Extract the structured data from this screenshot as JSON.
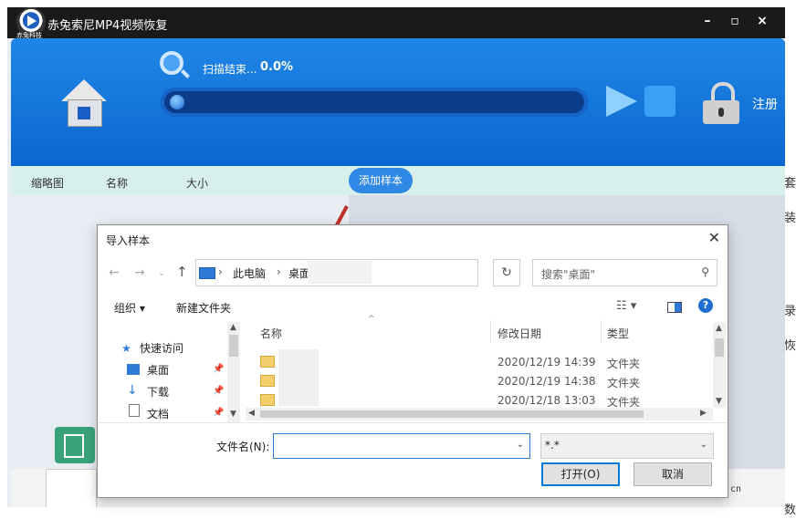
{
  "app": {
    "title": "赤兔索尼MP4视频恢复",
    "logo_text": "赤兔科技",
    "window_controls": [
      "–",
      "▫",
      "×"
    ],
    "scan_status": "扫描结束...",
    "scan_percent": "0.0%",
    "scan_progress": 0.0,
    "register_label": "注册",
    "columns": [
      "缩略图",
      "名称",
      "大小"
    ],
    "add_sample_label": "添加样本",
    "bottom_text": "cn"
  },
  "right_glyphs": [
    "套",
    "装",
    "录",
    "恢",
    "数"
  ],
  "dialog": {
    "title": "导入样本",
    "close": "✕",
    "address": {
      "crumbs": [
        "此电脑",
        "桌面"
      ]
    },
    "search_placeholder": "搜索\"桌面\"",
    "commands": {
      "organize": "组织 ▾",
      "new_folder": "新建文件夹"
    },
    "nav_items": [
      {
        "label": "快速访问",
        "icon": "star-icon"
      },
      {
        "label": "桌面",
        "icon": "desktop-icon"
      },
      {
        "label": "下载",
        "icon": "download-icon"
      },
      {
        "label": "文档",
        "icon": "document-icon"
      }
    ],
    "headers": {
      "name": "名称",
      "date": "修改日期",
      "type": "类型"
    },
    "files": [
      {
        "date": "2020/12/19 14:39",
        "type": "文件夹"
      },
      {
        "date": "2020/12/19 14:38",
        "type": "文件夹"
      },
      {
        "date": "2020/12/18 13:03",
        "type": "文件夹"
      }
    ],
    "filename_label": "文件名(N):",
    "filename_value": "",
    "filter_value": "*.*",
    "open_label": "打开(O)",
    "cancel_label": "取消"
  },
  "colors": {
    "header_blue": "#1a7ee0",
    "toolbar": "#d8f0ec",
    "accent_red": "#c0302b"
  }
}
